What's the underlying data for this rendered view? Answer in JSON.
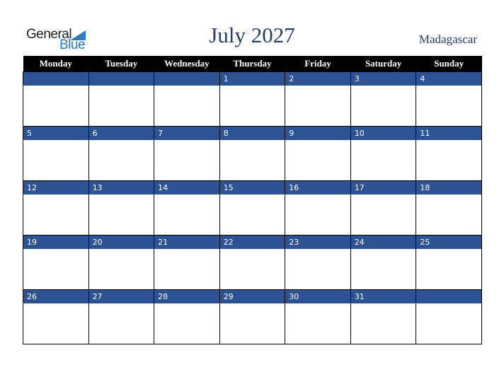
{
  "logo": {
    "line1": "General",
    "line2": "Blue"
  },
  "title": "July 2027",
  "country": "Madagascar",
  "weekdays": [
    "Monday",
    "Tuesday",
    "Wednesday",
    "Thursday",
    "Friday",
    "Saturday",
    "Sunday"
  ],
  "weeks": [
    [
      "",
      "",
      "",
      "1",
      "2",
      "3",
      "4"
    ],
    [
      "5",
      "6",
      "7",
      "8",
      "9",
      "10",
      "11"
    ],
    [
      "12",
      "13",
      "14",
      "15",
      "16",
      "17",
      "18"
    ],
    [
      "19",
      "20",
      "21",
      "22",
      "23",
      "24",
      "25"
    ],
    [
      "26",
      "27",
      "28",
      "29",
      "30",
      "31",
      ""
    ]
  ],
  "colors": {
    "header_bg": "#000000",
    "band": "#2d5394",
    "title": "#2b3f66",
    "logo_blue": "#2a7bbf"
  }
}
